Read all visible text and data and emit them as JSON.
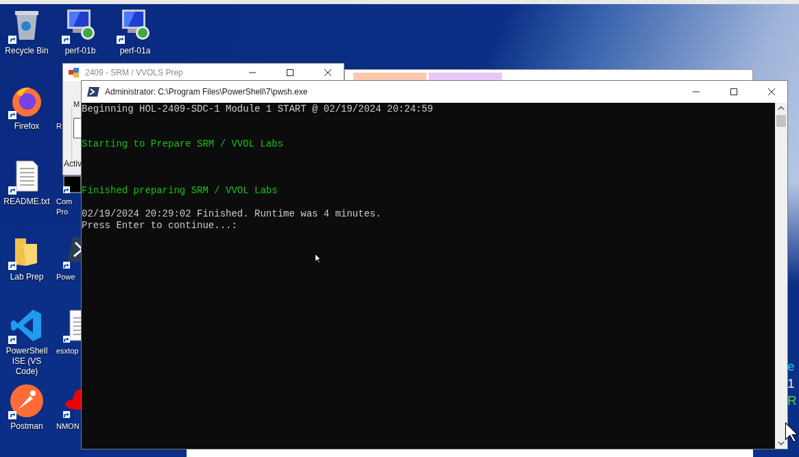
{
  "desktop_icons": [
    [
      {
        "label": "Recycle Bin",
        "kind": "recycle"
      },
      {
        "label": "Firefox",
        "kind": "firefox"
      },
      {
        "label": "README.txt",
        "kind": "text"
      },
      {
        "label": "Lab Prep",
        "kind": "folder"
      },
      {
        "label": "PowerShell ISE (VS Code)",
        "kind": "vscode"
      },
      {
        "label": "Postman",
        "kind": "postman"
      }
    ],
    [
      {
        "label": "perf-01b",
        "kind": "rdp"
      },
      {
        "label": "R",
        "kind": "hidden"
      },
      {
        "label": "Com\nPro",
        "kind": "cmd"
      },
      {
        "label": "Powe",
        "kind": "shell"
      },
      {
        "label": "esxtop",
        "kind": "text"
      },
      {
        "label": "NMON",
        "kind": "redhat"
      }
    ],
    [
      {
        "label": "perf-01a",
        "kind": "rdp"
      }
    ]
  ],
  "background_info": [
    {
      "text": "e",
      "color": "#1ec8e6"
    },
    {
      "text": "1",
      "color": "#e8e8e8"
    },
    {
      "text": "R",
      "color": "#5ad23c"
    }
  ],
  "prep_window": {
    "title": "2409 - SRM / VVOLS Prep",
    "group_label": "M",
    "status": "Activ"
  },
  "lab_window": {
    "tabs": [
      {
        "color": "#fcc9ae"
      },
      {
        "color": "#e8c8fa"
      }
    ]
  },
  "console": {
    "title": "Administrator: C:\\Program Files\\PowerShell\\7\\pwsh.exe",
    "lines": [
      {
        "text": "Beginning HOL-2409-SDC-1 Module 1 START @ 02/19/2024 20:24:59",
        "kind": "plain"
      },
      {
        "text": "Starting to Prepare SRM / VVOL Labs",
        "kind": "success"
      },
      {
        "text": "Finished preparing SRM / VVOL Labs",
        "kind": "success"
      },
      {
        "text": "02/19/2024 20:29:02 Finished. Runtime was 4 minutes.",
        "kind": "plain"
      },
      {
        "text": "Press Enter to continue...:",
        "kind": "plain"
      }
    ]
  }
}
